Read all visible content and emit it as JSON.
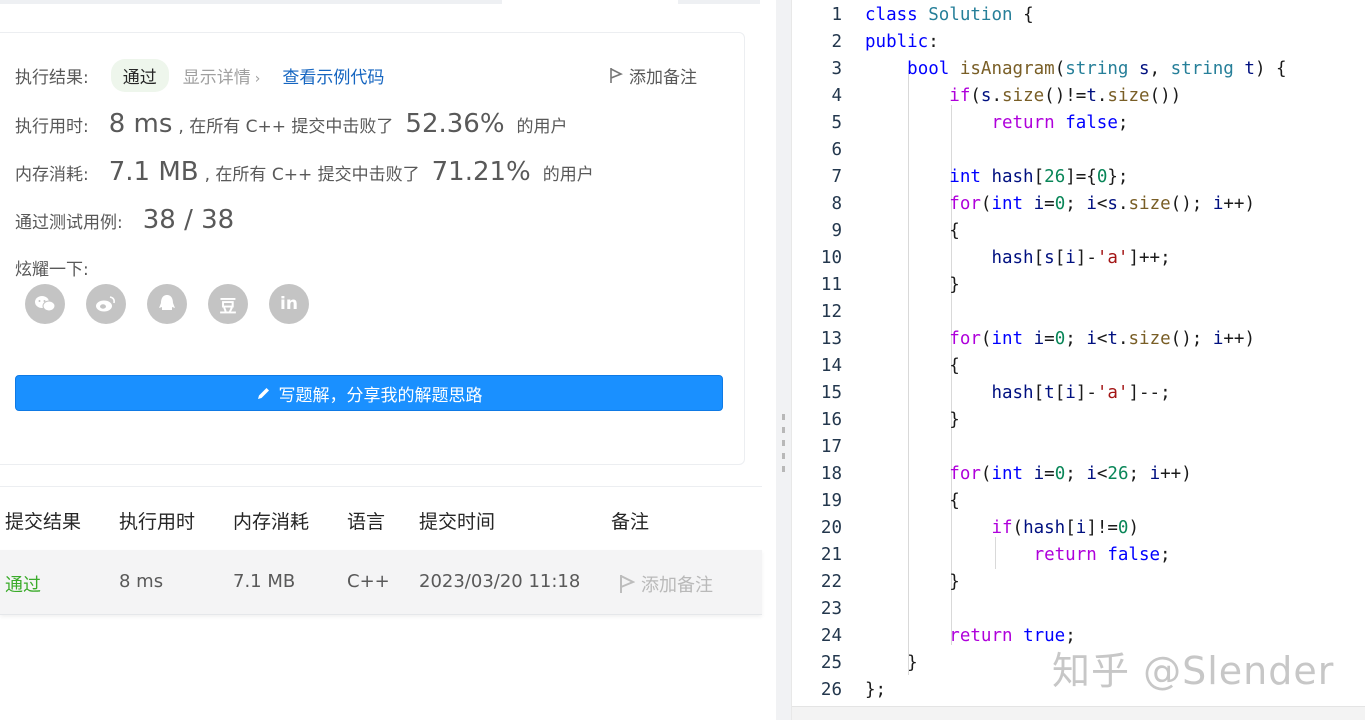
{
  "result": {
    "status_label": "执行结果:",
    "status_value": "通过",
    "show_detail": "显示详情",
    "view_sample": "查看示例代码",
    "add_note": "添加备注",
    "time_label": "执行用时:",
    "time_value": "8 ms",
    "time_mid": ", 在所有 C++ 提交中击败了",
    "time_pct": "52.36%",
    "users": "的用户",
    "mem_label": "内存消耗:",
    "mem_value": "7.1 MB",
    "mem_mid": ", 在所有 C++ 提交中击败了",
    "mem_pct": "71.21%",
    "cases_label": "通过测试用例:",
    "cases_value": "38 / 38",
    "share_label": "炫耀一下:",
    "share_icons": [
      "wechat-icon",
      "weibo-icon",
      "qq-icon",
      "douban-icon",
      "linkedin-icon"
    ],
    "share_glyphs": [
      "",
      "",
      "",
      "豆",
      "in"
    ],
    "write_solution": "写题解，分享我的解题思路"
  },
  "submissions": {
    "headers": [
      "提交结果",
      "执行用时",
      "内存消耗",
      "语言",
      "提交时间",
      "备注"
    ],
    "rows": [
      {
        "result": "通过",
        "time": "8 ms",
        "memory": "7.1 MB",
        "language": "C++",
        "submitted": "2023/03/20 11:18",
        "note": "添加备注"
      }
    ]
  },
  "editor": {
    "line_numbers": [
      "1",
      "2",
      "3",
      "4",
      "5",
      "6",
      "7",
      "8",
      "9",
      "10",
      "11",
      "12",
      "13",
      "14",
      "15",
      "16",
      "17",
      "18",
      "19",
      "20",
      "21",
      "22",
      "23",
      "24",
      "25",
      "26"
    ]
  },
  "watermark": "知乎 @Slender",
  "colors": {
    "accent": "#1a90ff",
    "pass_green": "#3aab2a",
    "link_blue": "#1565c0"
  }
}
